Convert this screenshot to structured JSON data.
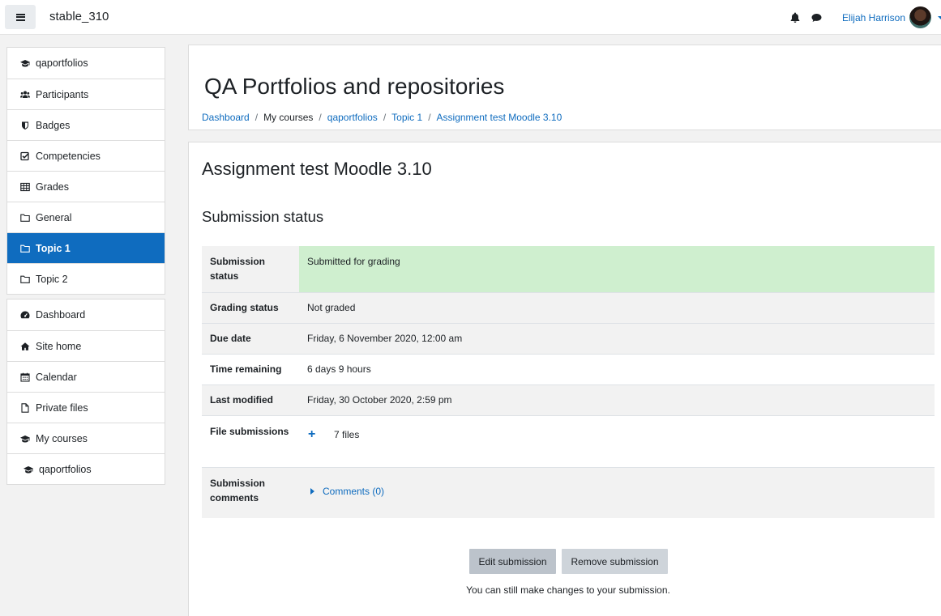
{
  "navbar": {
    "site_name": "stable_310",
    "user_name": "Elijah Harrison"
  },
  "sidebar": {
    "course_group": [
      {
        "label": "qaportfolios",
        "icon": "graduation-cap-icon"
      },
      {
        "label": "Participants",
        "icon": "users-icon"
      },
      {
        "label": "Badges",
        "icon": "shield-icon"
      },
      {
        "label": "Competencies",
        "icon": "check-square-icon"
      },
      {
        "label": "Grades",
        "icon": "table-icon"
      },
      {
        "label": "General",
        "icon": "folder-icon"
      },
      {
        "label": "Topic 1",
        "icon": "folder-icon",
        "active": true
      },
      {
        "label": "Topic 2",
        "icon": "folder-icon"
      }
    ],
    "site_group": [
      {
        "label": "Dashboard",
        "icon": "dashboard-icon"
      },
      {
        "label": "Site home",
        "icon": "home-icon"
      },
      {
        "label": "Calendar",
        "icon": "calendar-icon"
      },
      {
        "label": "Private files",
        "icon": "file-icon"
      },
      {
        "label": "My courses",
        "icon": "graduation-cap-icon"
      },
      {
        "label": "qaportfolios",
        "icon": "graduation-cap-icon"
      }
    ]
  },
  "header": {
    "title": "QA Portfolios and repositories",
    "breadcrumb": [
      {
        "label": "Dashboard",
        "link": true
      },
      {
        "label": "My courses",
        "link": false
      },
      {
        "label": "qaportfolios",
        "link": true
      },
      {
        "label": "Topic 1",
        "link": true
      },
      {
        "label": "Assignment test Moodle 3.10",
        "link": true
      }
    ]
  },
  "assignment": {
    "title": "Assignment test Moodle 3.10",
    "status_heading": "Submission status",
    "rows": {
      "submission_status": {
        "label": "Submission status",
        "value": "Submitted for grading"
      },
      "grading_status": {
        "label": "Grading status",
        "value": "Not graded"
      },
      "due_date": {
        "label": "Due date",
        "value": "Friday, 6 November 2020, 12:00 am"
      },
      "time_remaining": {
        "label": "Time remaining",
        "value": "6 days 9 hours"
      },
      "last_modified": {
        "label": "Last modified",
        "value": "Friday, 30 October 2020, 2:59 pm"
      },
      "file_submissions": {
        "label": "File submissions",
        "value": "7 files"
      },
      "submission_comments": {
        "label": "Submission comments",
        "value": "Comments (0)"
      }
    },
    "buttons": {
      "edit": "Edit submission",
      "remove": "Remove submission"
    },
    "help_text": "You can still make changes to your submission."
  },
  "colors": {
    "accent": "#0f6cbf",
    "submitted_bg": "#cfefcf"
  }
}
